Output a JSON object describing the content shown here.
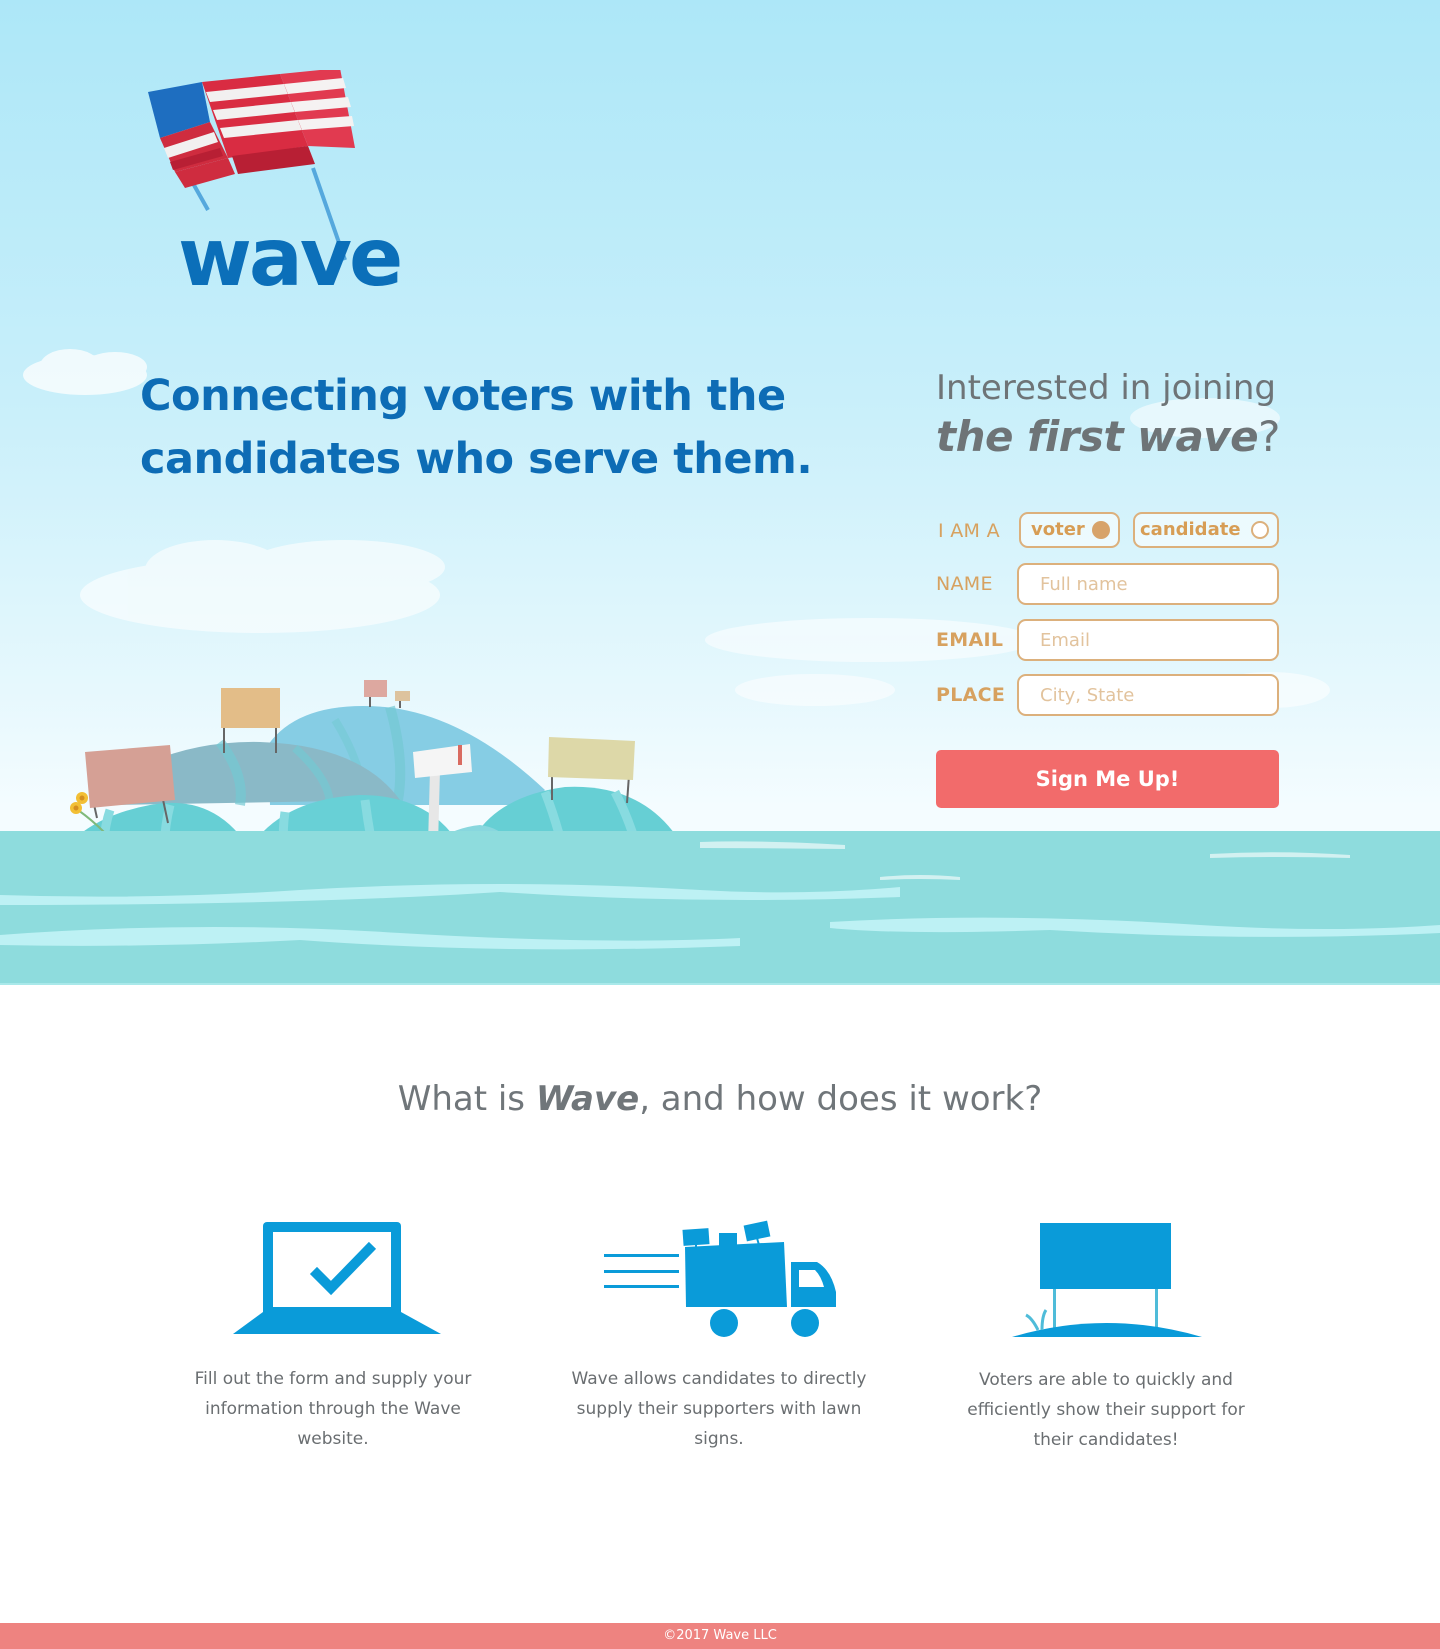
{
  "brand": {
    "name": "wave",
    "flag_colors": {
      "canton": "#1e6ec0",
      "stripe_red": "#cf2c3f",
      "stripe_white": "#f2f0f0"
    },
    "brand_color": "#0b6fb9"
  },
  "hero": {
    "headline": "Connecting voters with the candidates who serve them.",
    "scene_icons": [
      "island-icon",
      "lawn-sign-icon",
      "mailbox-icon",
      "flower-icon",
      "cloud-icon",
      "ocean-waves-icon"
    ]
  },
  "signup": {
    "intro": "Interested in joining",
    "title_first": "the first wave",
    "title_mark": "?",
    "role_label": "I AM A",
    "roles": [
      {
        "label": "voter",
        "selected": true
      },
      {
        "label": "candidate",
        "selected": false
      }
    ],
    "name_label": "NAME",
    "name_placeholder": "Full name",
    "email_label": "EMAIL",
    "email_placeholder": "Email",
    "place_label": "PLACE",
    "place_placeholder": "City, State",
    "submit_label": "Sign Me Up!",
    "accent_color": "#f26b6b",
    "field_color": "#d7a15f"
  },
  "how_it_works": {
    "title_before": "What is ",
    "title_brand": "Wave",
    "title_after": ", and how does it work?",
    "icon_color": "#0a9bd9",
    "steps": [
      {
        "icon": "laptop-check-icon",
        "text": "Fill out the form and supply your information through the Wave website."
      },
      {
        "icon": "delivery-truck-icon",
        "text": "Wave allows candidates to directly supply their supporters with lawn signs."
      },
      {
        "icon": "lawn-sign-icon",
        "text": "Voters are able to quickly and efficiently show their support for their candidates!"
      }
    ]
  },
  "footer": {
    "copyright": "©2017 Wave LLC",
    "color": "#ee8380"
  }
}
